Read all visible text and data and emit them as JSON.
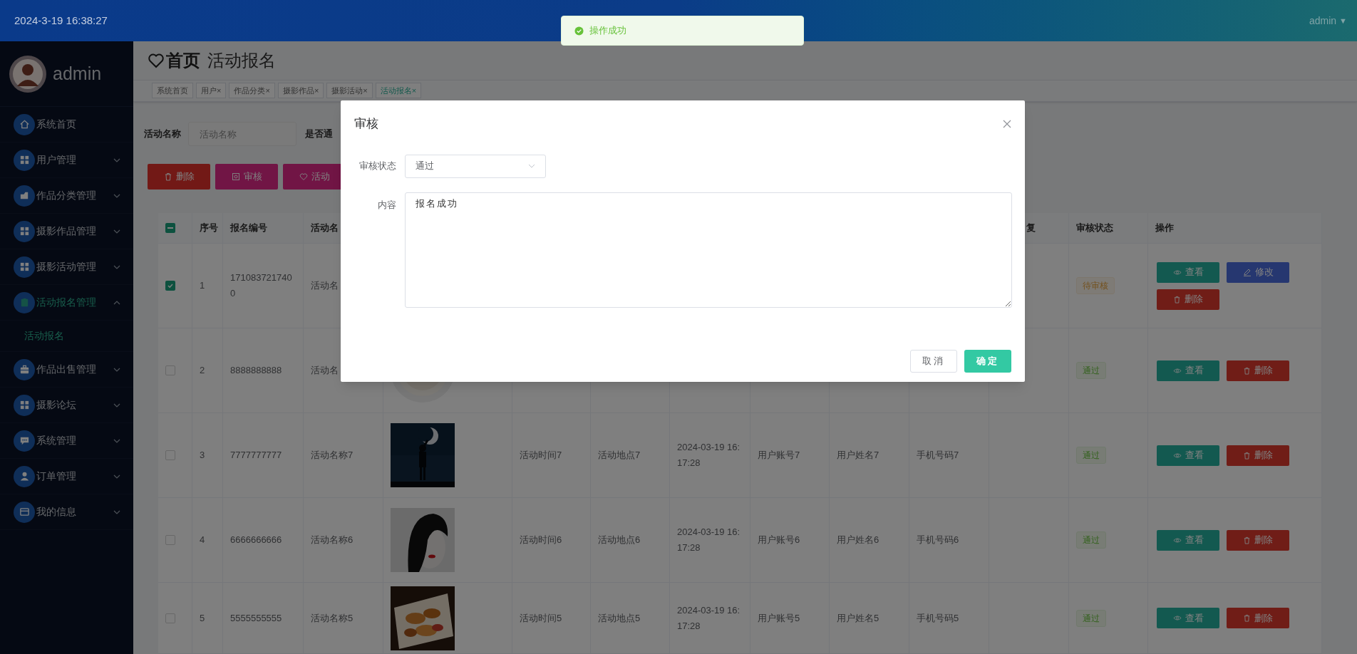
{
  "header": {
    "datetime": "2024-3-19 16:38:27",
    "user": "admin",
    "user_caret": "▼"
  },
  "toast": {
    "message": "操作成功"
  },
  "sidebar": {
    "user": "admin",
    "items": [
      {
        "label": "系统首页",
        "kind": "link",
        "selected": false
      },
      {
        "label": "用户管理",
        "kind": "menu",
        "expanded": false,
        "selected": false
      },
      {
        "label": "作品分类管理",
        "kind": "menu",
        "expanded": false,
        "selected": false
      },
      {
        "label": "摄影作品管理",
        "kind": "menu",
        "expanded": false,
        "selected": false
      },
      {
        "label": "摄影活动管理",
        "kind": "menu",
        "expanded": false,
        "selected": false
      },
      {
        "label": "活动报名管理",
        "kind": "menu",
        "expanded": true,
        "selected": true,
        "children": [
          {
            "label": "活动报名",
            "selected": true
          }
        ]
      },
      {
        "label": "作品出售管理",
        "kind": "menu",
        "expanded": false,
        "selected": false
      },
      {
        "label": "摄影论坛",
        "kind": "menu",
        "expanded": false,
        "selected": false
      },
      {
        "label": "系统管理",
        "kind": "menu",
        "expanded": false,
        "selected": false
      },
      {
        "label": "订单管理",
        "kind": "menu",
        "expanded": false,
        "selected": false
      },
      {
        "label": "我的信息",
        "kind": "menu",
        "expanded": false,
        "selected": false
      }
    ]
  },
  "breadcrumb": {
    "home": "首页",
    "current": "活动报名"
  },
  "tabs": [
    {
      "label": "系统首页",
      "selected": false
    },
    {
      "label": "用户",
      "close": "×",
      "selected": false
    },
    {
      "label": "作品分类",
      "close": "×",
      "selected": false
    },
    {
      "label": "摄影作品",
      "close": "×",
      "selected": false
    },
    {
      "label": "摄影活动",
      "close": "×",
      "selected": false
    },
    {
      "label": "活动报名",
      "close": "×",
      "selected": true
    }
  ],
  "filter": {
    "label": "活动名称",
    "placeholder": "活动名称",
    "label_2": "是否通"
  },
  "toolbar": [
    {
      "label": "删除",
      "kind": "delete"
    },
    {
      "label": "审核",
      "kind": "review"
    },
    {
      "label": "活动",
      "kind": "activity"
    }
  ],
  "table": {
    "header_checkbox": {
      "indeterminate": true
    },
    "columns": [
      "",
      "序号",
      "报名编号",
      "活动名",
      "",
      "",
      "",
      "",
      "",
      "",
      "",
      "复",
      "审核状态",
      "操作"
    ],
    "rows": [
      {
        "checked": true,
        "index": "1",
        "number": "1710837217400",
        "activity": "活动名",
        "status": {
          "label": "待审核",
          "kind": "pending"
        },
        "actions": [
          {
            "label": "查看",
            "kind": "view"
          },
          {
            "label": "修改",
            "kind": "edit"
          },
          {
            "label": "删除",
            "kind": "delete"
          }
        ]
      },
      {
        "checked": false,
        "index": "2",
        "number": "8888888888",
        "activity": "活动名",
        "image": {
          "kind": "picture"
        },
        "status": {
          "label": "通过",
          "kind": "passed"
        },
        "actions": [
          {
            "label": "查看",
            "kind": "view"
          },
          {
            "label": "删除",
            "kind": "delete"
          }
        ]
      },
      {
        "checked": false,
        "index": "3",
        "number": "7777777777",
        "activity": "活动名称7",
        "image": {
          "kind": "picture"
        },
        "time": "活动时间7",
        "place": "活动地点7",
        "date": "2024-03-19 16:\n17:28",
        "account": "用户账号7",
        "user_name": "用户姓名7",
        "phone": "手机号码7",
        "status": {
          "label": "通过",
          "kind": "passed"
        },
        "actions": [
          {
            "label": "查看",
            "kind": "view"
          },
          {
            "label": "删除",
            "kind": "delete"
          }
        ]
      },
      {
        "checked": false,
        "index": "4",
        "number": "6666666666",
        "activity": "活动名称6",
        "image": {
          "kind": "picture"
        },
        "time": "活动时间6",
        "place": "活动地点6",
        "date": "2024-03-19 16:\n17:28",
        "account": "用户账号6",
        "user_name": "用户姓名6",
        "phone": "手机号码6",
        "status": {
          "label": "通过",
          "kind": "passed"
        },
        "actions": [
          {
            "label": "查看",
            "kind": "view"
          },
          {
            "label": "删除",
            "kind": "delete"
          }
        ]
      },
      {
        "checked": false,
        "index": "5",
        "number": "5555555555",
        "activity": "活动名称5",
        "image": {
          "kind": "picture"
        },
        "time": "活动时间5",
        "place": "活动地点5",
        "date": "2024-03-19 16:\n17:28",
        "account": "用户账号5",
        "user_name": "用户姓名5",
        "phone": "手机号码5",
        "status": {
          "label": "通过",
          "kind": "passed"
        },
        "actions": [
          {
            "label": "查看",
            "kind": "view"
          },
          {
            "label": "删除",
            "kind": "delete"
          }
        ]
      }
    ]
  },
  "dialog": {
    "title": "审核",
    "status_label": "审核状态",
    "status_value": "通过",
    "content_label": "内容",
    "content_value": "报名成功",
    "buttons": [
      {
        "label": "取消",
        "kind": "cancel"
      },
      {
        "label": "确定",
        "kind": "confirm"
      }
    ]
  }
}
